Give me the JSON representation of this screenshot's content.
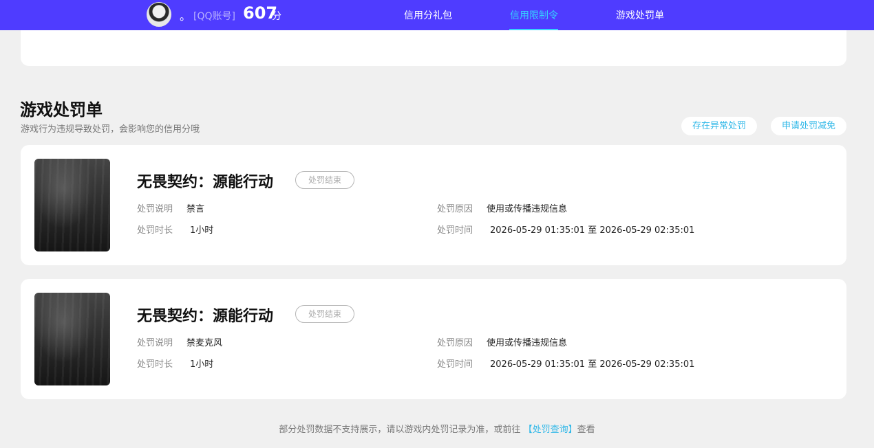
{
  "header": {
    "dot": "。",
    "account": "[QQ账号]",
    "score": "607",
    "score_unit": "分",
    "nav": [
      {
        "label": "信用分礼包",
        "active": false
      },
      {
        "label": "信用限制令",
        "active": true
      },
      {
        "label": "游戏处罚单",
        "active": false
      }
    ]
  },
  "section": {
    "title": "游戏处罚单",
    "subtitle": "游戏行为违规导致处罚，会影响您的信用分哦",
    "actions": [
      "存在异常处罚",
      "申请处罚减免"
    ]
  },
  "labels": {
    "desc": "处罚说明",
    "reason": "处罚原因",
    "duration": "处罚时长",
    "time": "处罚时间"
  },
  "penalties": [
    {
      "game": "无畏契约：源能行动",
      "status": "处罚结束",
      "desc": "禁言",
      "reason": "使用或传播违规信息",
      "duration": "1小时",
      "time": "2026-05-29 01:35:01 至 2026-05-29 02:35:01"
    },
    {
      "game": "无畏契约：源能行动",
      "status": "处罚结束",
      "desc": "禁麦克风",
      "reason": "使用或传播违规信息",
      "duration": "1小时",
      "time": "2026-05-29 01:35:01 至 2026-05-29 02:35:01"
    }
  ],
  "footer": {
    "text": "部分处罚数据不支持展示，请以游戏内处罚记录为准，或前往",
    "link": "【处罚查询】",
    "suffix": "查看"
  },
  "colors": {
    "topbar": "#4f3cff",
    "accent": "#35d1ff",
    "link": "#31b8e8",
    "page_bg": "#f0f0f0"
  }
}
